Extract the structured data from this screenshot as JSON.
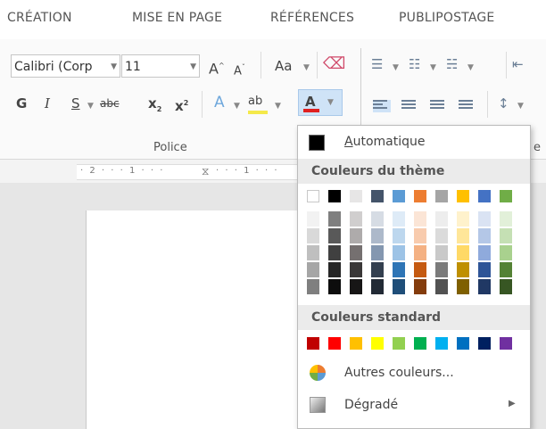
{
  "tabs": [
    "CRÉATION",
    "MISE EN PAGE",
    "RÉFÉRENCES",
    "PUBLIPOSTAGE"
  ],
  "ribbon": {
    "font_name": "Calibri (Corp",
    "font_size": "11",
    "grow_font": "A",
    "shrink_font": "A",
    "change_case": "Aa",
    "bold": "G",
    "italic": "I",
    "underline": "S",
    "strikethrough": "abc",
    "subscript": "x",
    "subscript_mark": "2",
    "superscript": "x",
    "superscript_mark": "2",
    "text_effects": "A",
    "highlight": "ab",
    "font_color": "A",
    "font_color_value": "#e02020",
    "group_label": "Police",
    "paragraph_label_partial": "e"
  },
  "ruler": {
    "ticks": "· 2 · · · 1 · · ·",
    "ticks_right": "· · · 1 · · ·"
  },
  "menu": {
    "automatic": "Automatique",
    "automatic_accesskey": "A",
    "automatic_rest": "utomatique",
    "theme_colors_label": "Couleurs du thème",
    "theme_top": [
      "#ffffff",
      "#000000",
      "#e7e6e6",
      "#44546a",
      "#5b9bd5",
      "#ed7d31",
      "#a5a5a5",
      "#ffc000",
      "#4472c4",
      "#70ad47"
    ],
    "theme_shades": [
      [
        "#f2f2f2",
        "#d9d9d9",
        "#bfbfbf",
        "#a6a6a6",
        "#7f7f7f"
      ],
      [
        "#7f7f7f",
        "#595959",
        "#404040",
        "#262626",
        "#0d0d0d"
      ],
      [
        "#d0cece",
        "#aeabab",
        "#757070",
        "#3a3838",
        "#171616"
      ],
      [
        "#d6dce4",
        "#adb9ca",
        "#8497b0",
        "#333f4f",
        "#222a35"
      ],
      [
        "#deebf7",
        "#bdd7ee",
        "#9dc3e6",
        "#2e75b6",
        "#1f4e79"
      ],
      [
        "#fbe5d6",
        "#f8cbad",
        "#f4b183",
        "#c55a11",
        "#843c0c"
      ],
      [
        "#ededed",
        "#dbdbdb",
        "#c9c9c9",
        "#7b7b7b",
        "#525252"
      ],
      [
        "#fff2cc",
        "#ffe699",
        "#ffd966",
        "#bf9000",
        "#7f6000"
      ],
      [
        "#dae3f3",
        "#b4c7e7",
        "#8faadc",
        "#2f5597",
        "#203864"
      ],
      [
        "#e2f0d9",
        "#c5e0b4",
        "#a9d18e",
        "#548235",
        "#375623"
      ]
    ],
    "standard_colors_label": "Couleurs standard",
    "standard_colors": [
      "#c00000",
      "#ff0000",
      "#ffc000",
      "#ffff00",
      "#92d050",
      "#00b050",
      "#00b0f0",
      "#0070c0",
      "#002060",
      "#7030a0"
    ],
    "more_colors": "Autres couleurs...",
    "gradient": "Dégradé"
  }
}
